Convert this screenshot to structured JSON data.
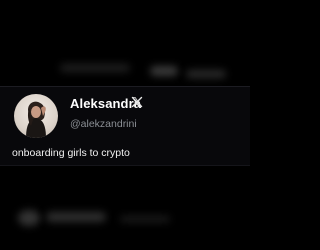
{
  "profile": {
    "display_name": "Aleksandra",
    "handle": "@alekzandrini",
    "bio": "onboarding girls to crypto",
    "platform_icon": "x-logo-icon",
    "avatar_icon": "profile-photo"
  },
  "colors": {
    "background": "#000000",
    "card": "#08080b",
    "name": "#ffffff",
    "handle": "#8b8f95",
    "bio": "#f2f2f2"
  }
}
